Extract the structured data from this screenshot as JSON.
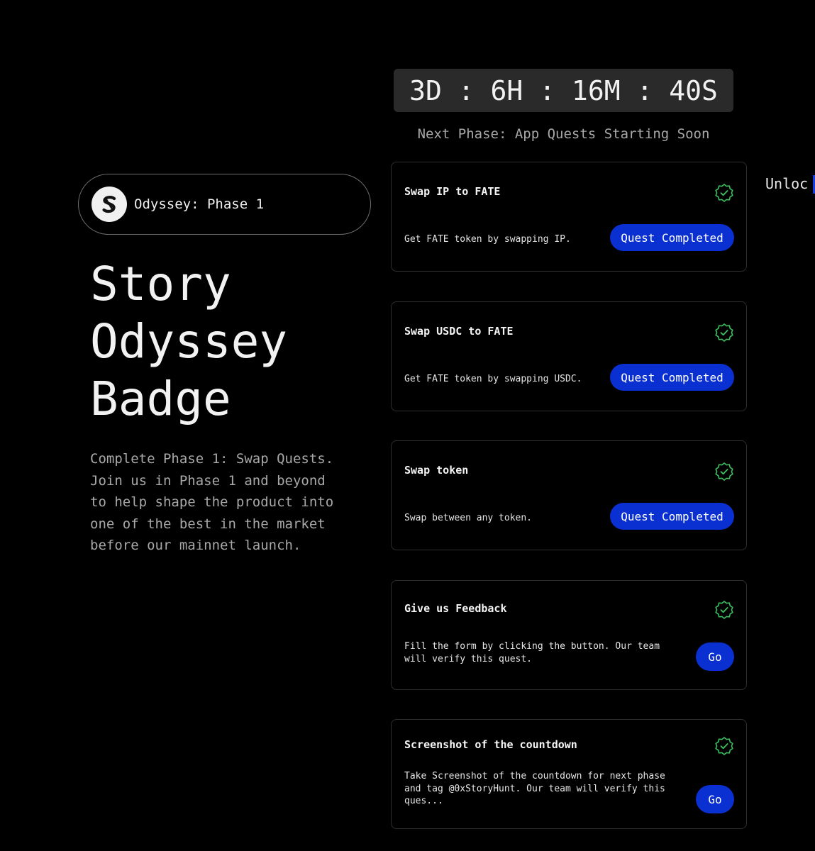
{
  "countdown": {
    "text": "3D : 6H : 16M : 40S"
  },
  "next_phase": "Next Phase: App Quests Starting Soon",
  "phase_pill": {
    "label": "Odyssey: Phase 1"
  },
  "title_lines": [
    "Story",
    "Odyssey",
    "Badge"
  ],
  "description_lines": [
    "Complete Phase 1: Swap Quests.",
    "Join us in Phase 1 and beyond",
    "to help shape the product into",
    "one of the best in the market",
    "before our mainnet launch."
  ],
  "unlock_text": "Unloc",
  "colors": {
    "accent": "#0a30d2",
    "check": "#3fbf5f",
    "background": "#000000",
    "muted_text": "#a8a8a8"
  },
  "icons": {
    "logo": "story-s-logo-icon",
    "check": "check-badge-icon"
  },
  "quests": [
    {
      "title": "Swap IP to FATE",
      "description_lines": [
        "Get FATE token by swapping IP."
      ],
      "button": "Quest Completed"
    },
    {
      "title": "Swap USDC to FATE",
      "description_lines": [
        "Get FATE token by swapping USDC."
      ],
      "button": "Quest Completed"
    },
    {
      "title": "Swap token",
      "description_lines": [
        "Swap between any token."
      ],
      "button": "Quest Completed"
    },
    {
      "title": "Give us Feedback",
      "description_lines": [
        "Fill the form by clicking the button. Our team",
        "will verify this quest."
      ],
      "button": "Go"
    },
    {
      "title": "Screenshot of the countdown",
      "description_lines": [
        "Take Screenshot of the countdown for next phase",
        "and tag @0xStoryHunt. Our team will verify this",
        "ques..."
      ],
      "button": "Go"
    }
  ]
}
